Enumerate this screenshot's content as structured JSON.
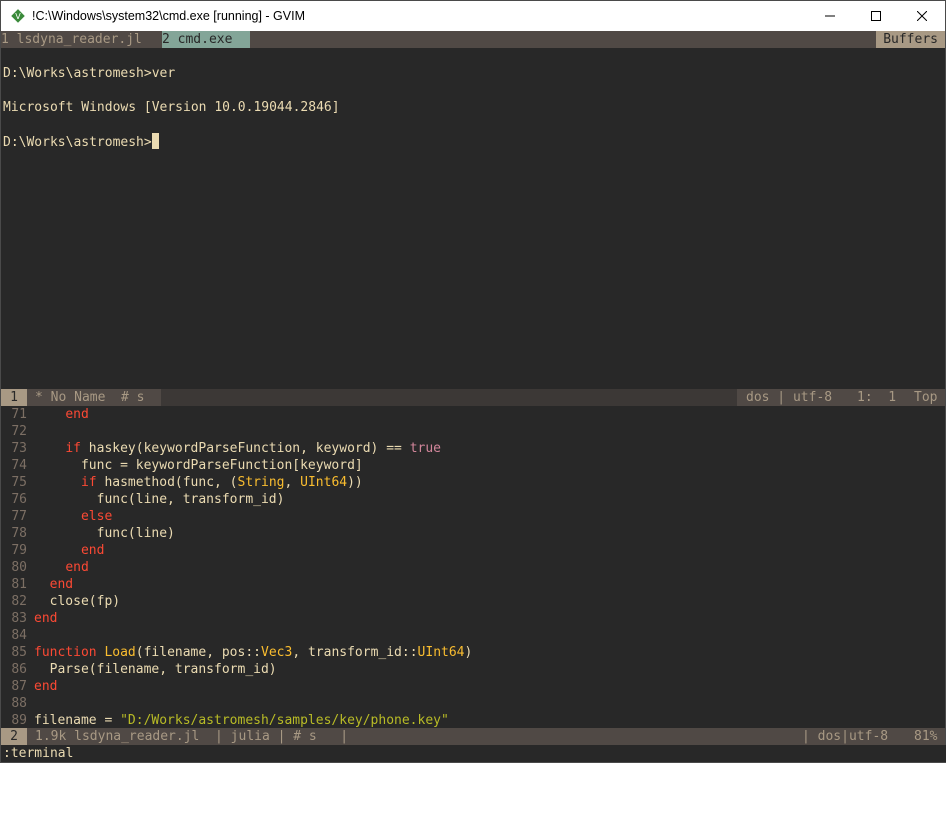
{
  "window": {
    "title": "!C:\\Windows\\system32\\cmd.exe [running] - GVIM",
    "controls": {
      "minimize": "—",
      "maximize": "☐",
      "close": "✕"
    }
  },
  "tabline": {
    "tabs": [
      {
        "label": "1 lsdyna_reader.jl"
      },
      {
        "label": "2 cmd.exe"
      }
    ],
    "buffers_label": "Buffers"
  },
  "terminal": {
    "lines": [
      "D:\\Works\\astromesh>ver",
      "",
      "Microsoft Windows [Version 10.0.19044.2846]",
      "",
      "D:\\Works\\astromesh>"
    ]
  },
  "top_status": {
    "win_num": "1",
    "name": "* No Name",
    "hash": "# s",
    "format": "dos | utf-8",
    "position": "1:  1",
    "scroll": "Top"
  },
  "editor": {
    "lines": [
      {
        "n": "71",
        "parts": [
          [
            "",
            "    "
          ],
          [
            "kw",
            "end"
          ]
        ]
      },
      {
        "n": "72",
        "parts": []
      },
      {
        "n": "73",
        "parts": [
          [
            "",
            "    "
          ],
          [
            "kw",
            "if"
          ],
          [
            "",
            " haskey(keywordParseFunction, keyword) == "
          ],
          [
            "bl",
            "true"
          ]
        ]
      },
      {
        "n": "74",
        "parts": [
          [
            "",
            "      func = keywordParseFunction[keyword]"
          ]
        ]
      },
      {
        "n": "75",
        "parts": [
          [
            "",
            "      "
          ],
          [
            "kw",
            "if"
          ],
          [
            "",
            " hasmethod(func, ("
          ],
          [
            "ty",
            "String"
          ],
          [
            "",
            ", "
          ],
          [
            "ty",
            "UInt64"
          ],
          [
            "",
            "))"
          ]
        ]
      },
      {
        "n": "76",
        "parts": [
          [
            "",
            "        func(line, transform_id)"
          ]
        ]
      },
      {
        "n": "77",
        "parts": [
          [
            "",
            "      "
          ],
          [
            "kw",
            "else"
          ]
        ]
      },
      {
        "n": "78",
        "parts": [
          [
            "",
            "        func(line)"
          ]
        ]
      },
      {
        "n": "79",
        "parts": [
          [
            "",
            "      "
          ],
          [
            "kw",
            "end"
          ]
        ]
      },
      {
        "n": "80",
        "parts": [
          [
            "",
            "    "
          ],
          [
            "kw",
            "end"
          ]
        ]
      },
      {
        "n": "81",
        "parts": [
          [
            "",
            "  "
          ],
          [
            "kw",
            "end"
          ]
        ]
      },
      {
        "n": "82",
        "parts": [
          [
            "",
            "  close(fp)"
          ]
        ]
      },
      {
        "n": "83",
        "parts": [
          [
            "kw",
            "end"
          ]
        ]
      },
      {
        "n": "84",
        "parts": []
      },
      {
        "n": "85",
        "parts": [
          [
            "kw",
            "function"
          ],
          [
            "",
            " "
          ],
          [
            "fn",
            "Load"
          ],
          [
            "",
            "(filename, pos::"
          ],
          [
            "ty",
            "Vec3"
          ],
          [
            "",
            ", transform_id::"
          ],
          [
            "ty",
            "UInt64"
          ],
          [
            "",
            ")"
          ]
        ]
      },
      {
        "n": "86",
        "parts": [
          [
            "",
            "  Parse(filename, transform_id)"
          ]
        ]
      },
      {
        "n": "87",
        "parts": [
          [
            "kw",
            "end"
          ]
        ]
      },
      {
        "n": "88",
        "parts": []
      },
      {
        "n": "89",
        "parts": [
          [
            "",
            "filename = "
          ],
          [
            "st",
            "\"D:/Works/astromesh/samples/key/phone.key\""
          ]
        ]
      }
    ]
  },
  "bottom_status": {
    "win_num": "2",
    "info": "1.9k lsdyna_reader.jl  | julia | # s   |",
    "format": "| dos|utf-8",
    "percent": "81%"
  },
  "cmdline": ":terminal"
}
